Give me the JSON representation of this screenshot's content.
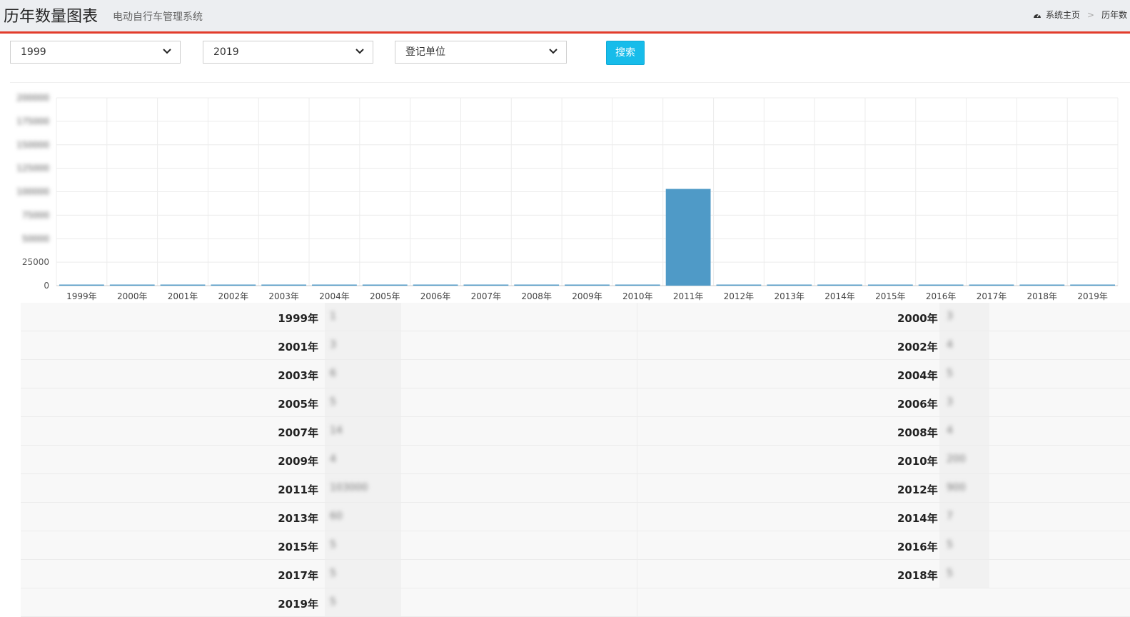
{
  "header": {
    "title": "历年数量图表",
    "subtitle": "电动自行车管理系统",
    "breadcrumb": [
      "系统主页",
      "历年数"
    ]
  },
  "filters": {
    "start_year": "1999",
    "end_year": "2019",
    "unit": "登记单位",
    "search_label": "搜索"
  },
  "chart_data": {
    "type": "bar",
    "categories": [
      "1999年",
      "2000年",
      "2001年",
      "2002年",
      "2003年",
      "2004年",
      "2005年",
      "2006年",
      "2007年",
      "2008年",
      "2009年",
      "2010年",
      "2011年",
      "2012年",
      "2013年",
      "2014年",
      "2015年",
      "2016年",
      "2017年",
      "2018年",
      "2019年"
    ],
    "values": [
      1,
      3,
      3,
      4,
      6,
      5,
      5,
      3,
      14,
      4,
      4,
      200,
      103000,
      900,
      60,
      7,
      5,
      5,
      5,
      5,
      5
    ],
    "yticks": [
      0,
      25000,
      50000,
      75000,
      100000,
      125000,
      150000,
      175000,
      200000
    ],
    "ytick_labels": [
      "0",
      "25000",
      "50000",
      "75000",
      "100000",
      "125000",
      "150000",
      "175000",
      "200000"
    ],
    "ylim": [
      0,
      200000
    ],
    "grid": true,
    "colors": {
      "bar": "#4f9ac7",
      "grid": "#ececec"
    }
  },
  "summary": [
    {
      "year": "1999年",
      "value": "1"
    },
    {
      "year": "2000年",
      "value": "3"
    },
    {
      "year": "2001年",
      "value": "3"
    },
    {
      "year": "2002年",
      "value": "4"
    },
    {
      "year": "2003年",
      "value": "6"
    },
    {
      "year": "2004年",
      "value": "5"
    },
    {
      "year": "2005年",
      "value": "5"
    },
    {
      "year": "2006年",
      "value": "3"
    },
    {
      "year": "2007年",
      "value": "14"
    },
    {
      "year": "2008年",
      "value": "4"
    },
    {
      "year": "2009年",
      "value": "4"
    },
    {
      "year": "2010年",
      "value": "200"
    },
    {
      "year": "2011年",
      "value": "103000"
    },
    {
      "year": "2012年",
      "value": "900"
    },
    {
      "year": "2013年",
      "value": "60"
    },
    {
      "year": "2014年",
      "value": "7"
    },
    {
      "year": "2015年",
      "value": "5"
    },
    {
      "year": "2016年",
      "value": "5"
    },
    {
      "year": "2017年",
      "value": "5"
    },
    {
      "year": "2018年",
      "value": "5"
    },
    {
      "year": "2019年",
      "value": "5"
    }
  ]
}
